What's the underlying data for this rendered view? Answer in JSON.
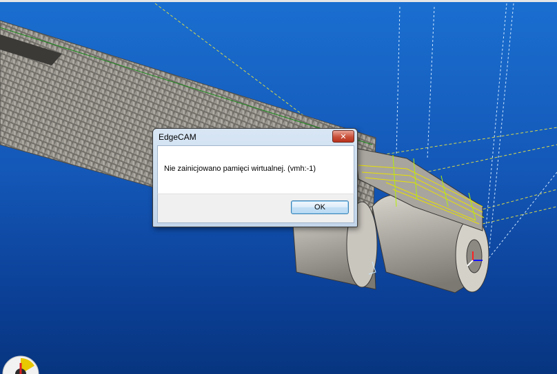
{
  "dialog": {
    "title": "EdgeCAM",
    "message": "Nie zainicjowano pamięci wirtualnej. (vmh:-1)",
    "ok_label": "OK",
    "close_icon": "✕"
  },
  "colors": {
    "background_top": "#1a6fd0",
    "background_bottom": "#07357f",
    "part_metal": "#c7c4bc",
    "toolpath_green": "#b5f000",
    "toolpath_yellow": "#e8e000",
    "toolpath_white": "#c8e8ff"
  },
  "icons": {
    "close": "close-icon",
    "axis_triad": "axis-triad-icon",
    "view_orientation": "view-orientation-icon"
  }
}
